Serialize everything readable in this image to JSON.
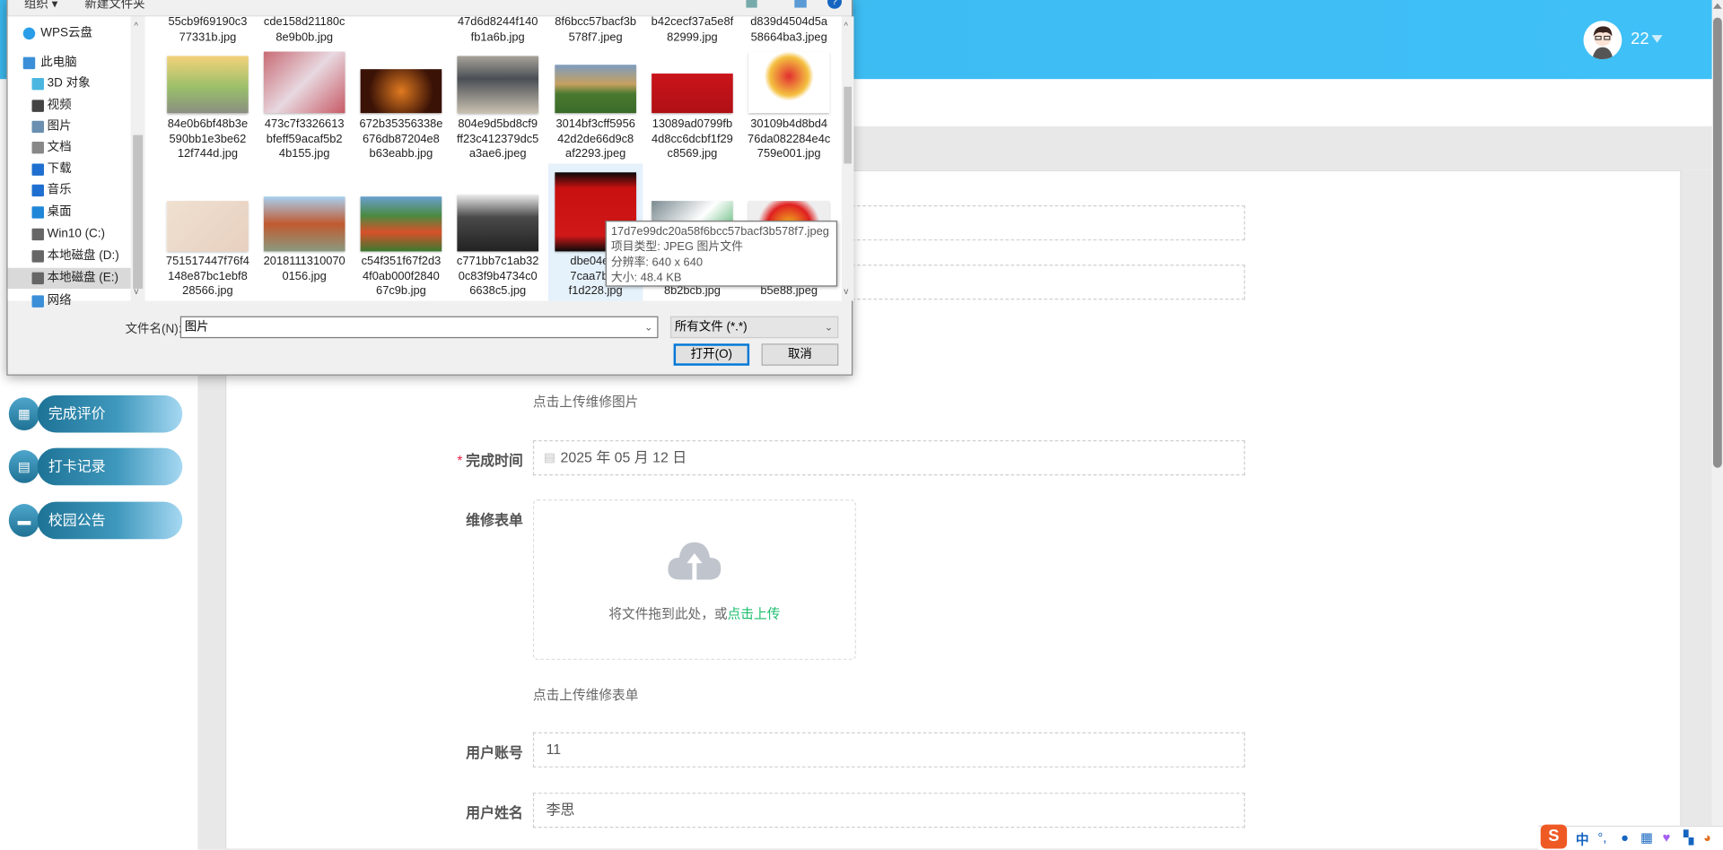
{
  "header": {
    "username": "22",
    "bg_color": "#3dbdf5"
  },
  "sidebar": {
    "items": [
      {
        "label": "完成评价",
        "icon": "grid-icon"
      },
      {
        "label": "打卡记录",
        "icon": "clipboard-icon"
      },
      {
        "label": "校园公告",
        "icon": "monitor-icon"
      }
    ]
  },
  "form": {
    "upload_image_hint": "点击上传维修图片",
    "finish_time": {
      "label": "完成时间",
      "required": true,
      "value": "2025 年 05 月 12 日"
    },
    "repair_form": {
      "label": "维修表单",
      "drop_text": "将文件拖到此处，或",
      "click_text": "点击上传",
      "hint": "点击上传维修表单"
    },
    "user_account": {
      "label": "用户账号",
      "value": "11"
    },
    "user_name": {
      "label": "用户姓名",
      "value": "李思"
    },
    "accent": "#19be6b"
  },
  "dialog": {
    "toolbar": {
      "organize": "组织 ▾",
      "new_folder": "新建文件夹"
    },
    "nav": [
      {
        "label": "WPS云盘",
        "icon": "cloud-icon"
      },
      {
        "label": "此电脑",
        "icon": "computer-icon"
      },
      {
        "label": "3D 对象",
        "icon": "cube-icon"
      },
      {
        "label": "视频",
        "icon": "video-icon"
      },
      {
        "label": "图片",
        "icon": "picture-icon"
      },
      {
        "label": "文档",
        "icon": "document-icon"
      },
      {
        "label": "下载",
        "icon": "download-icon"
      },
      {
        "label": "音乐",
        "icon": "music-icon"
      },
      {
        "label": "桌面",
        "icon": "desktop-icon"
      },
      {
        "label": "Win10 (C:)",
        "icon": "drive-icon"
      },
      {
        "label": "本地磁盘 (D:)",
        "icon": "drive-icon"
      },
      {
        "label": "本地磁盘 (E:)",
        "icon": "drive-icon",
        "selected": true
      },
      {
        "label": "网络",
        "icon": "network-icon"
      }
    ],
    "files_row1": [
      [
        "55cb9f69190c3",
        "77331b.jpg"
      ],
      [
        "cde158d21180c",
        "8e9b0b.jpg"
      ],
      [],
      [
        "47d6d8244f140",
        "fb1a6b.jpg"
      ],
      [
        "8f6bcc57bacf3b",
        "578f7.jpeg"
      ],
      [
        "b42cecf37a5e8f",
        "82999.jpg"
      ],
      [
        "d839d4504d5a",
        "58664ba3.jpeg"
      ]
    ],
    "files_row2": [
      [
        "84e0b6bf48b3e",
        "590bb1e3be62",
        "12f744d.jpg"
      ],
      [
        "473c7f3326613",
        "bfeff59acaf5b2",
        "4b155.jpg"
      ],
      [
        "672b35356338e",
        "676db87204e8",
        "b63eabb.jpg"
      ],
      [
        "804e9d5bd8cf9",
        "ff23c412379dc5",
        "a3ae6.jpeg"
      ],
      [
        "3014bf3cff5956",
        "42d2de66d9c8",
        "af2293.jpeg"
      ],
      [
        "13089ad0799fb",
        "4d8cc6dcbf1f29",
        "c8569.jpg"
      ],
      [
        "30109b4d8bd4",
        "76da082284e4c",
        "759e001.jpg"
      ]
    ],
    "files_row3": [
      [
        "751517447f76f4",
        "148e87bc1ebf8",
        "28566.jpg"
      ],
      [
        "2018111310070",
        "0156.jpg"
      ],
      [
        "c54f351f67f2d3",
        "4f0ab000f2840",
        "67c9b.jpg"
      ],
      [
        "c771bb7c1ab32",
        "0c83f9b4734c0",
        "6638c5.jpg"
      ],
      [
        "dbe04e4c",
        "7caa7b16",
        "f1d228.jpg"
      ],
      [
        "",
        "",
        "8b2bcb.jpg"
      ],
      [
        "",
        "",
        "b5e88.jpeg"
      ]
    ],
    "tooltip": {
      "name": "17d7e99dc20a58f6bcc57bacf3b578f7.jpeg",
      "type": "项目类型: JPEG 图片文件",
      "resolution": "分辨率: 640 x 640",
      "size": "大小: 48.4 KB"
    },
    "filename_label": "文件名(N):",
    "filename_value": "图片",
    "filter": "所有文件 (*.*)",
    "open": "打开(O)",
    "cancel": "取消"
  },
  "ime": {
    "lang": "中",
    "punct": "°,"
  }
}
